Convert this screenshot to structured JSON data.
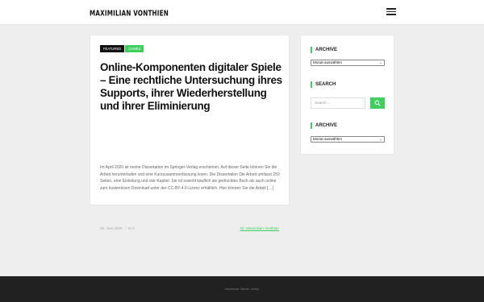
{
  "header": {
    "logo_text": "Maximilian Vonthien",
    "menu_icon": "hamburger-menu-icon"
  },
  "post": {
    "tags": [
      "FEATURED",
      "GAMES"
    ],
    "title": "Online-Komponenten digitaler Spiele – Eine rechtliche Untersuchung ihres Supports, ihrer Wiederherstellung und ihrer Eliminierung",
    "excerpt": "Im April 2020 ist meine Dissertation im Springer-Verlag erschienen. Auf dieser Seite können Sie die Arbeit herunterladen und eine Kurzzusammenfassung lesen. Die Dissertation Die Arbeit umfasst 250 Seiten, eine Einleitung und vier Kapitel. Sie ist sowohl käuflich als gedrucktes Buch als auch online zum kostenlosen Download unter der CC-BY-4.0-Lizenz erhältlich. Hier können Sie die Arbeit […]",
    "date": "25. Juni 2020",
    "comments": "0",
    "author": "Dr. Maximilian Vonthien"
  },
  "sidebar": {
    "archive1": {
      "title": "ARCHIVE",
      "select_value": "Monat auswählen"
    },
    "search": {
      "title": "SEARCH",
      "placeholder": "Search ..."
    },
    "archive2": {
      "title": "ARCHIVE",
      "select_value": "Monat auswählen"
    }
  },
  "footer": {
    "text": "Inoplanpa Starter vorlup"
  },
  "colors": {
    "accent": "#3ecf5e",
    "footer_bg": "#212121",
    "page_bg": "#eeeeee"
  }
}
